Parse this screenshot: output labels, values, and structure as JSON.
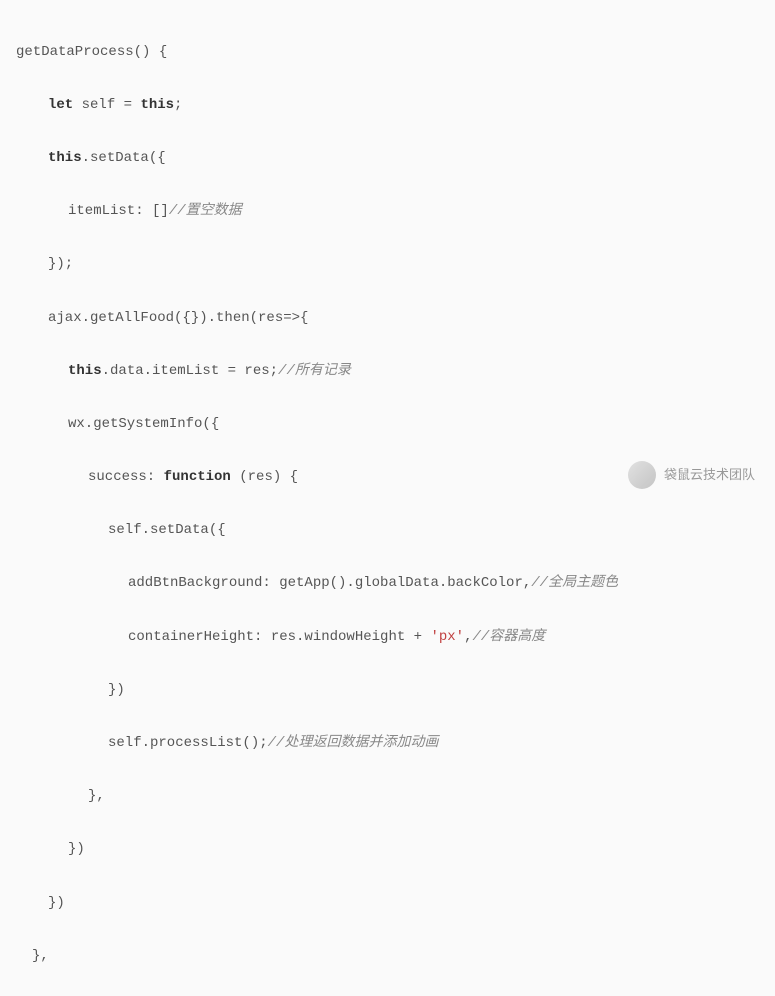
{
  "code": {
    "l1_a": "getDataProcess() {",
    "l2_kw1": "let",
    "l2_a": " self = ",
    "l2_kw2": "this",
    "l2_b": ";",
    "l3_kw1": "this",
    "l3_a": ".setData({",
    "l4_a": "itemList: []",
    "l4_c": "//置空数据",
    "l5_a": "});",
    "l6_a": "ajax.getAllFood({}).then(res=>{",
    "l7_kw1": "this",
    "l7_a": ".data.itemList = res;",
    "l7_c": "//所有记录",
    "l8_a": "wx.getSystemInfo({",
    "l9_a": "success: ",
    "l9_kw1": "function",
    "l9_b": " (res) {",
    "l10_a": "self.setData({",
    "l11_a": "addBtnBackground: getApp().globalData.backColor,",
    "l11_c": "//全局主题色",
    "l12_a": "containerHeight: res.windowHeight + ",
    "l12_s": "'px'",
    "l12_b": ",",
    "l12_c": "//容器高度",
    "l13_a": "})",
    "l14_a": "self.processList();",
    "l14_c": "//处理返回数据并添加动画",
    "l15_a": "},",
    "l16_a": "})",
    "l17_a": "})",
    "l18_a": "},"
  },
  "watermark": {
    "text": "袋鼠云技术团队"
  }
}
